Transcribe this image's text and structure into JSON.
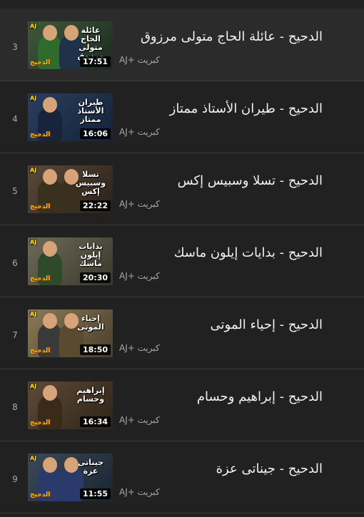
{
  "playlist": {
    "items": [
      {
        "index": "3",
        "title": "الدحيح - عائلة الحاج متولى مرزوق",
        "channel": "كبريت +AJ",
        "duration": "17:51",
        "thumb_caption": "عائلة الحاج متولى مرزوق",
        "active": true,
        "palette": {
          "bg1": "#3f5a3a",
          "bg2": "#1c2a20",
          "p1": "#2f6b2a",
          "p2": "#20324a"
        }
      },
      {
        "index": "4",
        "title": "الدحيح - طيران الأستاذ ممتاز",
        "channel": "كبريت +AJ",
        "duration": "16:06",
        "thumb_caption": "طيران الأستاذ ممتاز",
        "active": false,
        "palette": {
          "bg1": "#2a3f5e",
          "bg2": "#132238",
          "p1": "#18243a",
          "p2": "#18243a"
        }
      },
      {
        "index": "5",
        "title": "الدحيح - تسلا وسبيس إكس",
        "channel": "كبريت +AJ",
        "duration": "22:22",
        "thumb_caption": "تسلا وسبيس إكس",
        "active": false,
        "palette": {
          "bg1": "#5a4a3a",
          "bg2": "#2a2018",
          "p1": "#3a3020",
          "p2": "#3a3020"
        }
      },
      {
        "index": "6",
        "title": "الدحيح - بدايات إيلون ماسك",
        "channel": "كبريت +AJ",
        "duration": "20:30",
        "thumb_caption": "بدايات إيلون ماسك",
        "active": false,
        "palette": {
          "bg1": "#6e6a58",
          "bg2": "#3a382c",
          "p1": "#2e4a2a",
          "p2": "#2e4a2a"
        }
      },
      {
        "index": "7",
        "title": "الدحيح - إحياء الموتى",
        "channel": "كبريت +AJ",
        "duration": "18:50",
        "thumb_caption": "إحياء الموتى",
        "active": false,
        "palette": {
          "bg1": "#8a7a56",
          "bg2": "#4a3e2a",
          "p1": "#3a3a3a",
          "p2": "#5a4a30"
        }
      },
      {
        "index": "8",
        "title": "الدحيح - إبراهيم وحسام",
        "channel": "كبريت +AJ",
        "duration": "16:34",
        "thumb_caption": "إبراهيم وحسام",
        "active": false,
        "palette": {
          "bg1": "#5e4a36",
          "bg2": "#2e2418",
          "p1": "#3a2a1a",
          "p2": "#4a3a2a"
        }
      },
      {
        "index": "9",
        "title": "الدحيح - جيناتى عزة",
        "channel": "كبريت +AJ",
        "duration": "11:55",
        "thumb_caption": "جيناتى عزة",
        "active": false,
        "palette": {
          "bg1": "#3a4a5a",
          "bg2": "#1a2430",
          "p1": "#2a3a6a",
          "p2": "#2a3a6a"
        }
      }
    ],
    "thumb_logo_aj": "AJ",
    "thumb_logo_show": "الدحيح"
  }
}
